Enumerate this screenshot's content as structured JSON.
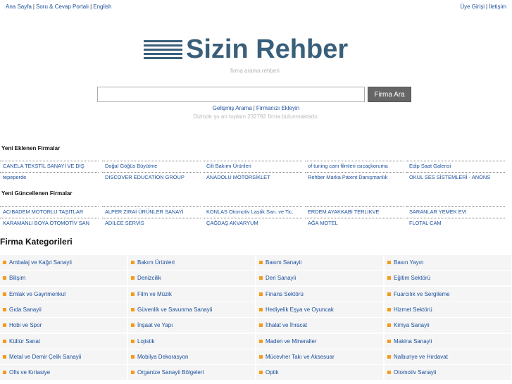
{
  "topbar": {
    "left": [
      "Ana Sayfa",
      "Soru & Cevap Portalı",
      "English"
    ],
    "right": [
      "Üye Girişi",
      "İletişim"
    ]
  },
  "logo": {
    "text": "Sizin Rehber",
    "subtitle": "firma arama rehberi"
  },
  "search": {
    "placeholder": "",
    "button": "Firma Ara",
    "links": [
      "Gelişmiş Arama",
      "Firmanızı Ekleyin"
    ],
    "stats": "Dizinde şu an toplam 232792 firma bulunmaktadır."
  },
  "new_firms": {
    "title": "Yeni Eklenen Firmalar",
    "rows": [
      [
        "CANELA TEKSTİL SANAYİ VE DIŞ",
        "Doğal Göğüs Büyütme",
        "Cilt Bakımı Ürünleri",
        "of tuning cam filmleri ısıcaçkoruma",
        "Edip Saat Galerisi"
      ],
      [
        "tepeperde",
        "DISCOVER EDUCATION GROUP",
        "ANADOLU MOTORSİKLET",
        "Rehber Marka Patent Danışmanlık",
        "OKUL SES SİSTEMLERİ - ANONS"
      ]
    ]
  },
  "updated_firms": {
    "title": "Yeni Güncellenen Firmalar",
    "rows": [
      [
        "ACIBADEM MOTORLU TAŞITLAR",
        "ALPER ZİRAİ ÜRÜNLER SANAYİ",
        "KONLAS Otomotiv Lastik San. ve Tic.",
        "ERDEM AYAKKABI TERLİKVE",
        "SARANLAR YEMEK EVİ"
      ],
      [
        "KARAMANLI BOYA OTOMOTİV SAN",
        "ADİLCE SERVİS",
        "ÇAĞDAŞ AKVARYUM",
        "AĞA MOTEL",
        "FLOTAL CAM"
      ]
    ]
  },
  "categories": {
    "title": "Firma Kategorileri",
    "rows": [
      [
        "Ambalaj ve Kağıt Sanayii",
        "Bakım Ürünleri",
        "Basım Sanayii",
        "Basın Yayın"
      ],
      [
        "Bilişim",
        "Denizcilik",
        "Deri Sanayii",
        "Eğitim Sektörü"
      ],
      [
        "Emlak ve Gayrimenkul",
        "Film ve Müzik",
        "Finans Sektörü",
        "Fuarcılık ve Sergileme"
      ],
      [
        "Gıda Sanayii",
        "Güvenlik ve Savunma Sanayii",
        "Hediyelik Eşya ve Oyuncak",
        "Hizmet Sektörü"
      ],
      [
        "Hobi ve Spor",
        "İnşaat ve Yapı",
        "İthalat ve İhracat",
        "Kimya Sanayii"
      ],
      [
        "Kültür Sanat",
        "Lojistik",
        "Maden ve Mineraller",
        "Makina Sanayii"
      ],
      [
        "Metal ve Demir Çelik Sanayii",
        "Mobilya Dekorasyon",
        "Mücevher Takı ve Aksesuar",
        "Nalburiye ve Hırdavat"
      ],
      [
        "Ofis ve Kırtasiye",
        "Organize Sanayii Bölgeleri",
        "Optik",
        "Otomotiv Sanayii"
      ]
    ]
  },
  "colors": {
    "brand": "#3a5f7a",
    "link": "#1a4f9c",
    "bullet": "#f59b1a"
  }
}
